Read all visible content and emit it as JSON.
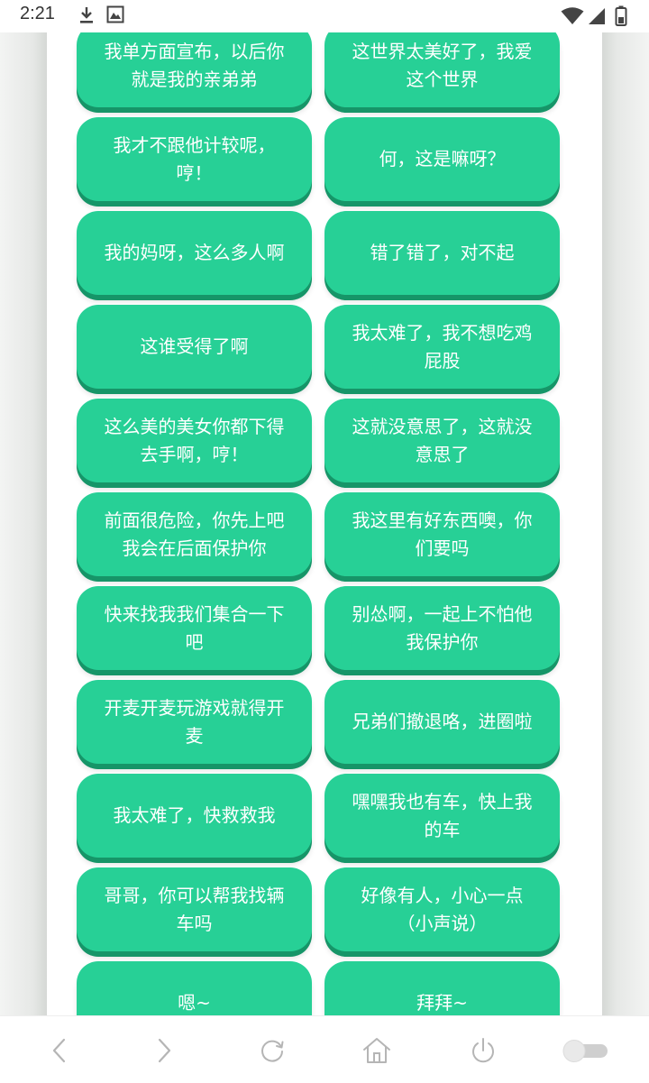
{
  "status_bar": {
    "time": "2:21"
  },
  "voice_buttons": [
    "我单方面宣布，以后你就是我的亲弟弟",
    "这世界太美好了，我爱这个世界",
    "我才不跟他计较呢，哼！",
    "何，这是嘛呀？",
    "我的妈呀，这么多人啊",
    "错了错了，对不起",
    "这谁受得了啊",
    "我太难了，我不想吃鸡屁股",
    "这么美的美女你都下得去手啊，哼！",
    "这就没意思了，这就没意思了",
    "前面很危险，你先上吧 我会在后面保护你",
    "我这里有好东西噢，你们要吗",
    "快来找我我们集合一下吧",
    "别怂啊，一起上不怕他 我保护你",
    "开麦开麦玩游戏就得开麦",
    "兄弟们撤退咯，进圈啦",
    "我太难了，快救救我",
    "嘿嘿我也有车，快上我的车",
    "哥哥，你可以帮我找辆车吗",
    "好像有人，小心一点（小声说）",
    "嗯~",
    "拜拜~"
  ],
  "bottom_nav": {
    "icons": [
      "back-arrow-icon",
      "forward-arrow-icon",
      "refresh-icon",
      "home-icon",
      "power-icon",
      "toggle-icon"
    ]
  }
}
